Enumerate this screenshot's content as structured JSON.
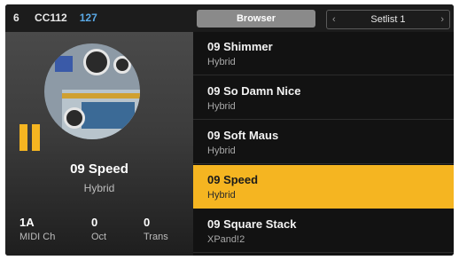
{
  "topbar": {
    "channel": "6",
    "cc_label": "CC112",
    "cc_value": "127",
    "browser_label": "Browser",
    "setlist_label": "Setlist 1",
    "prev_glyph": "‹",
    "next_glyph": "›"
  },
  "current_patch": {
    "name": "09 Speed",
    "type": "Hybrid",
    "artwork_icon": "synth-panel-artwork",
    "indicator_color": "#f5b521"
  },
  "params": [
    {
      "value": "1A",
      "label": "MIDI Ch"
    },
    {
      "value": "0",
      "label": "Oct"
    },
    {
      "value": "0",
      "label": "Trans"
    }
  ],
  "patches": [
    {
      "name": "09 Shimmer",
      "type": "Hybrid"
    },
    {
      "name": "09 So Damn Nice",
      "type": "Hybrid"
    },
    {
      "name": "09 Soft Maus",
      "type": "Hybrid"
    },
    {
      "name": "09 Speed",
      "type": "Hybrid"
    },
    {
      "name": "09 Square Stack",
      "type": "XPand!2"
    }
  ],
  "selected_index": 3,
  "colors": {
    "accent": "#f5b521",
    "cc_value": "#5aa9e6",
    "background": "#141414"
  }
}
